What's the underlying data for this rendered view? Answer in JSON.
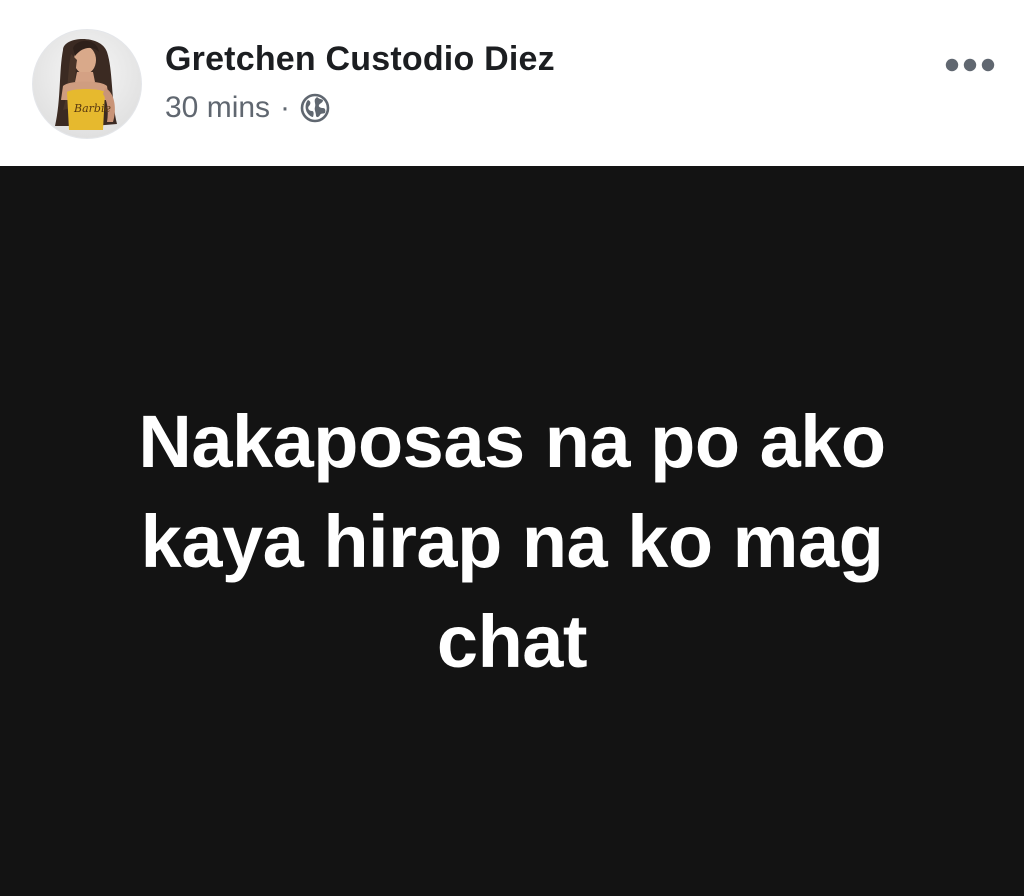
{
  "post": {
    "author_name": "Gretchen Custodio Diez",
    "timestamp": "30 mins",
    "separator": "·",
    "privacy_icon": "globe-icon",
    "more_icon": "more-options-icon",
    "avatar_shirt_text": "Barbie",
    "body_lines": [
      "Nakaposas na po ako",
      "kaya hirap na ko mag",
      "chat"
    ],
    "colors": {
      "background_card": "#131313",
      "text_on_card": "#ffffff",
      "name_text": "#1c1e21",
      "meta_text": "#606770"
    }
  }
}
